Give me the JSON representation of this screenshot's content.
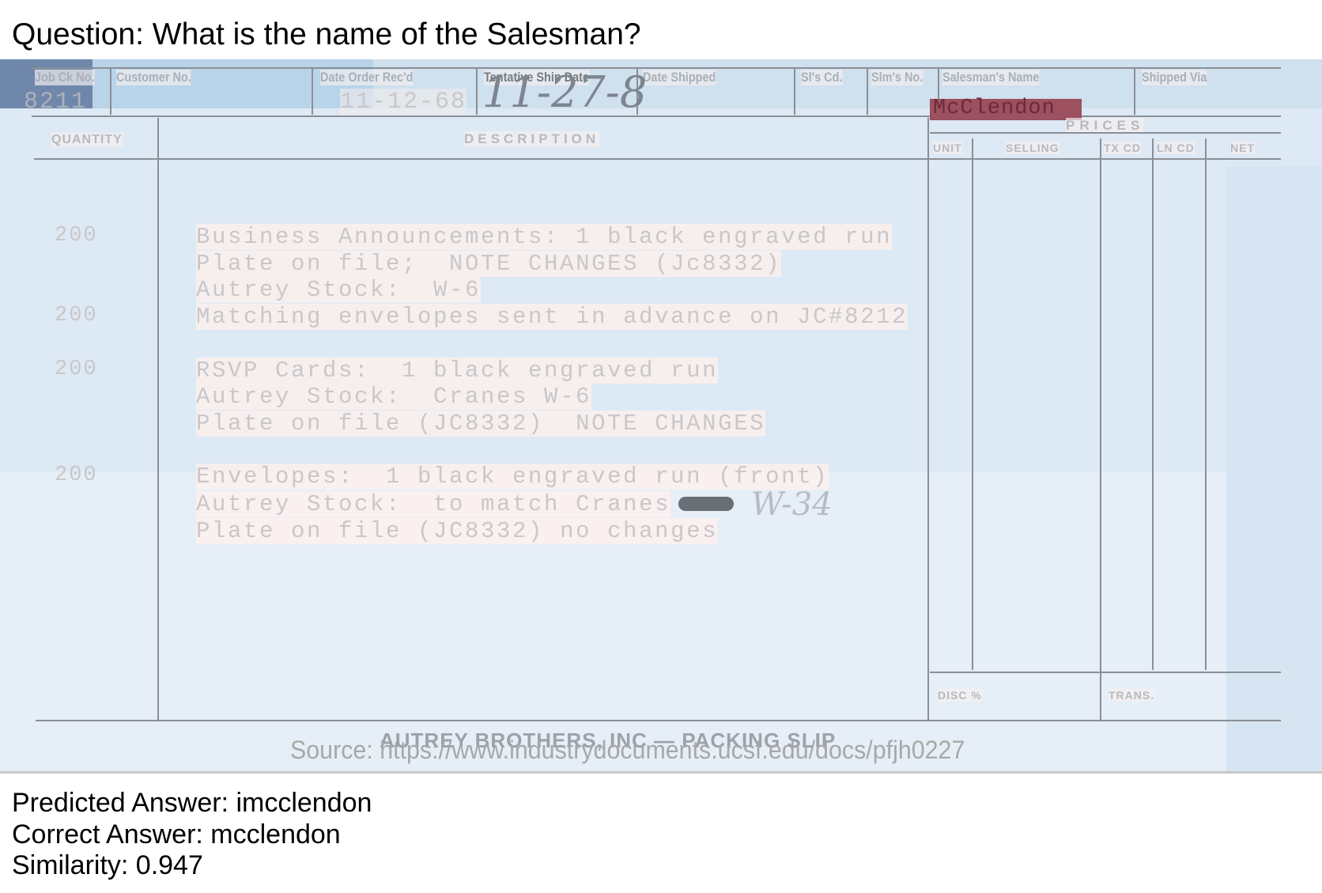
{
  "question": "Question: What is the name of the Salesman?",
  "form": {
    "headers": {
      "job_ck_no": "Job Ck No.",
      "customer_no": "Customer No.",
      "date_order_recd": "Date Order Rec'd",
      "tentative_ship_date": "Tentative Ship Date",
      "date_shipped": "Date Shipped",
      "sls_cd": "Sl's Cd.",
      "slms_no": "Slm's No.",
      "salesmans_name": "Salesman's Name",
      "shipped_via": "Shipped Via"
    },
    "values": {
      "job_ck_no": "8211",
      "date_order_recd": "11-12-68",
      "tentative_ship_date": "11-27-8",
      "salesmans_name": "McClendon"
    },
    "columns": {
      "quantity": "QUANTITY",
      "description": "DESCRIPTION",
      "prices": "PRICES",
      "unit": "UNIT",
      "selling": "SELLING",
      "tx_cd": "TX CD",
      "ln_cd": "LN CD",
      "net": "NET",
      "disc": "DISC %",
      "trans": "TRANS."
    },
    "items": [
      {
        "qty": "200",
        "lines": [
          "Business Announcements: 1 black engraved run",
          "Plate on file;  NOTE CHANGES (Jc8332)",
          "Autrey Stock:  W-6"
        ]
      },
      {
        "qty": "200",
        "lines": [
          "Matching envelopes sent in advance on JC#8212"
        ]
      },
      {
        "qty": "200",
        "lines": [
          "RSVP Cards:  1 black engraved run",
          "Autrey Stock:  Cranes W-6",
          "Plate on file (JC8332)  NOTE CHANGES"
        ]
      },
      {
        "qty": "200",
        "lines": [
          "Envelopes:  1 black engraved run (front)",
          "Autrey Stock:  to match Cranes",
          "Plate on file (JC8332) no changes"
        ]
      }
    ],
    "handwritten_note": "W-34",
    "footer_title": "AUTREY BROTHERS, INC — PACKING SLIP"
  },
  "source": "Source: https://www.industrydocuments.ucsf.edu/docs/pfjh0227",
  "result": {
    "predicted": "Predicted Answer: imcclendon",
    "correct": "Correct Answer: mcclendon",
    "similarity": "Similarity: 0.947"
  },
  "colors": {
    "highlight_box": "#9c5060",
    "paper": "#e6eff7"
  }
}
